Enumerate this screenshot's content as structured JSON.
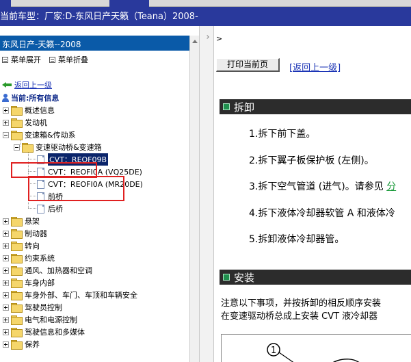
{
  "window": {
    "title": "当前车型：厂家:D-东风日产天籁（Teana）2008-"
  },
  "left": {
    "header": "东风日产-天籁--2008",
    "toolbar": {
      "expand_label": "菜单展开",
      "collapse_label": "菜单折叠"
    },
    "back_link": "返回上一级",
    "current": "当前:所有信息",
    "tree": [
      {
        "label": "概述信息",
        "state": "collapsed"
      },
      {
        "label": "发动机",
        "state": "collapsed"
      },
      {
        "label": "变速箱&传动系",
        "state": "expanded"
      },
      {
        "label": "变速驱动桥&变速箱",
        "state": "expanded"
      },
      {
        "label": "CVT：REOF09B",
        "state": "selected"
      },
      {
        "label": "CVT：REOF​I0A (VQ25DE)",
        "state": "leaf"
      },
      {
        "label": "CVT：REOF​I0A (MR20DE)",
        "state": "leaf"
      },
      {
        "label": "前桥",
        "state": "leaf"
      },
      {
        "label": "后桥",
        "state": "leaf"
      },
      {
        "label": "悬架",
        "state": "collapsed"
      },
      {
        "label": "制动器",
        "state": "collapsed"
      },
      {
        "label": "转向",
        "state": "collapsed"
      },
      {
        "label": "约束系统",
        "state": "collapsed"
      },
      {
        "label": "通风、加热器和空调",
        "state": "collapsed"
      },
      {
        "label": "车身内部",
        "state": "collapsed"
      },
      {
        "label": "车身外部、车门、车顶和车辆安全",
        "state": "collapsed"
      },
      {
        "label": "驾驶员控制",
        "state": "collapsed"
      },
      {
        "label": "电气和电源控制",
        "state": "collapsed"
      },
      {
        "label": "驾驶信息和多媒体",
        "state": "collapsed"
      },
      {
        "label": "保养",
        "state": "collapsed"
      }
    ]
  },
  "right": {
    "prefix": ">",
    "print_button": "打印当前页",
    "back_link": "[返回上一级]",
    "section_remove": "拆卸",
    "steps_remove": [
      "1.拆下前下盖。",
      "2.拆下翼子板保护板 (左侧)。",
      "3.拆下空气管道 (进气)。请参见",
      "4.拆下液体冷却器软管 A 和液体冷",
      "5.拆卸液体冷却器管。"
    ],
    "step3_link": "分",
    "section_install": "安装",
    "notes_install": [
      "注意以下事项，并按拆卸的相反顺序安装",
      "在变速驱动桥总成上安装 CVT 液冷却器"
    ],
    "diagram_label": "1"
  },
  "colors": {
    "topbar": "#29399c",
    "left_header": "#0a5aa8",
    "selection": "#0a246a",
    "highlight_box": "#e02020",
    "section_bar": "#2c2c2c",
    "section_icon": "#1f8f4e",
    "link": "#1a33b5"
  }
}
